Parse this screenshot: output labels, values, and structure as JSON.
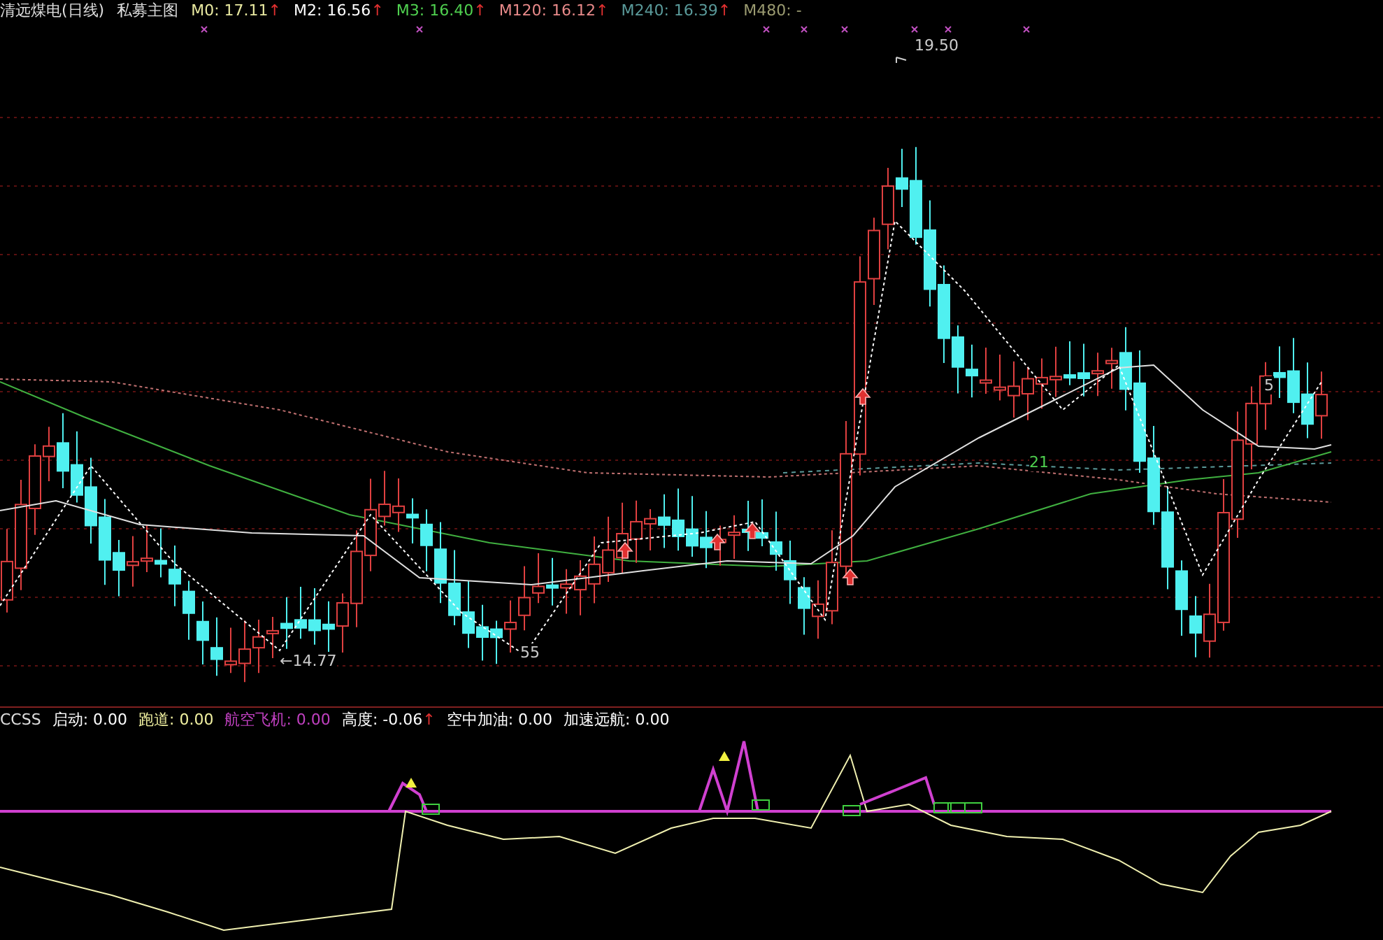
{
  "main_panel": {
    "title": "清远煤电(日线)",
    "indicator": "私募主图",
    "legend": [
      {
        "label": "M0: 17.11",
        "color": "#e8e8a0",
        "arrow": "↑"
      },
      {
        "label": "M2: 16.56",
        "color": "#ffffff",
        "arrow": "↑"
      },
      {
        "label": "M3: 16.40",
        "color": "#4fd04f",
        "arrow": "↑"
      },
      {
        "label": "M120: 16.12",
        "color": "#e88a8a",
        "arrow": "↑"
      },
      {
        "label": "M240: 16.39",
        "color": "#5a9a9a",
        "arrow": "↑"
      },
      {
        "label": "M480: -",
        "color": "#9a9a70"
      }
    ],
    "annotations": [
      {
        "text": "19.50",
        "kind": "high"
      },
      {
        "text": "←14.77",
        "kind": "low"
      },
      {
        "text": "55",
        "kind": "count"
      },
      {
        "text": "21",
        "kind": "count_green"
      },
      {
        "text": "5",
        "kind": "count"
      }
    ]
  },
  "sub_panel": {
    "name": "CCSS",
    "legend": [
      {
        "label": "启动: 0.00",
        "color": "#ffffff"
      },
      {
        "label": "跑道: 0.00",
        "color": "#f0f0a0"
      },
      {
        "label": "航空飞机: 0.00",
        "color": "#c040c0"
      },
      {
        "label": "高度: -0.06",
        "color": "#ffffff",
        "arrow": "↑"
      },
      {
        "label": "空中加油: 0.00",
        "color": "#ffffff"
      },
      {
        "label": "加速远航: 0.00",
        "color": "#ffffff"
      }
    ]
  }
}
